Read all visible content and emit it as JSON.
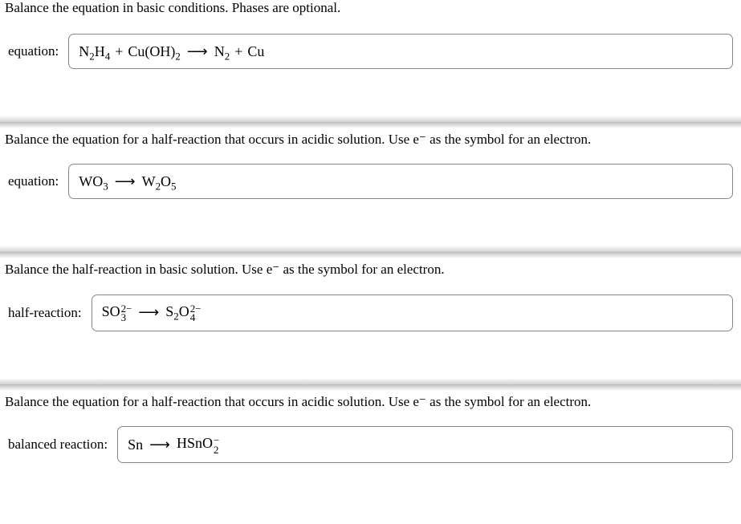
{
  "q1": {
    "prompt": "Balance the equation in basic conditions. Phases are optional.",
    "label": "equation:",
    "lhs1": "N",
    "lhs1_sub1": "2",
    "lhs1_mid": "H",
    "lhs1_sub2": "4",
    "plus1": "+",
    "lhs2": "Cu(OH)",
    "lhs2_sub": "2",
    "arrow": "⟶",
    "rhs1": "N",
    "rhs1_sub": "2",
    "plus2": "+",
    "rhs2": "Cu"
  },
  "q2": {
    "prompt": "Balance the equation for a half-reaction that occurs in acidic solution. Use e⁻ as the symbol for an electron.",
    "label": "equation:",
    "lhs1": "WO",
    "lhs1_sub": "3",
    "arrow": "⟶",
    "rhs1": "W",
    "rhs1_sub1": "2",
    "rhs1_mid": "O",
    "rhs1_sub2": "5"
  },
  "q3": {
    "prompt": "Balance the half-reaction in basic solution. Use e⁻ as the symbol for an electron.",
    "label": "half-reaction:",
    "lhs1": "SO",
    "lhs1_sup": "2−",
    "lhs1_sub": "3",
    "arrow": "⟶",
    "rhs1": "S",
    "rhs1_sub1": "2",
    "rhs1_mid": "O",
    "rhs1_sup": "2−",
    "rhs1_sub2": "4"
  },
  "q4": {
    "prompt": "Balance the equation for a half-reaction that occurs in acidic solution. Use e⁻ as the symbol for an electron.",
    "label": "balanced reaction:",
    "lhs1": "Sn",
    "arrow": "⟶",
    "rhs1": "HSnO",
    "rhs1_sup": "−",
    "rhs1_sub": "2"
  }
}
